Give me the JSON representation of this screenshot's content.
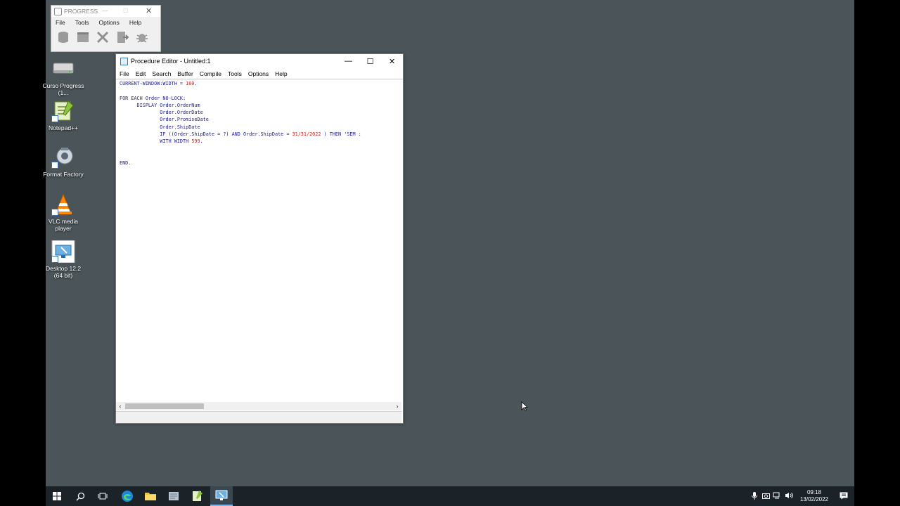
{
  "progress_window": {
    "title": "PROGRESS",
    "menu": [
      "File",
      "Tools",
      "Options",
      "Help"
    ],
    "toolbar_icons": [
      "database-icon",
      "window-icon",
      "cross-tools-icon",
      "document-arrow-icon",
      "bug-icon"
    ]
  },
  "desktop_icons": [
    {
      "label": "Curso Progress (1...",
      "icon": "drive-icon"
    },
    {
      "label": "Notepad++",
      "icon": "notepad-icon"
    },
    {
      "label": "Format Factory",
      "icon": "format-factory-icon"
    },
    {
      "label": "VLC media player",
      "icon": "vlc-icon"
    },
    {
      "label": "Desktop 12.2 (64 bit)",
      "icon": "progress-desktop-icon"
    }
  ],
  "editor": {
    "title": "Procedure Editor - Untitled:1",
    "menu": [
      "File",
      "Edit",
      "Search",
      "Buffer",
      "Compile",
      "Tools",
      "Options",
      "Help"
    ],
    "code": {
      "line1_kw": "CURRENT-WINDOW:WIDTH = ",
      "line1_num": "160",
      "line1_end": ".",
      "line3": "FOR EACH Order NO-LOCK:",
      "line4": "      DISPLAY Order.OrderNum",
      "line5": "              Order.OrderDate",
      "line6": "              Order.PromiseDate",
      "line7": "              Order.ShipDate",
      "line8_a": "              IF ((Order.ShipDate = ?) AND Order.ShipDate = ",
      "line8_date": "31/31/2022",
      "line8_b": " ) THEN 'SEM :",
      "line9_a": "              WITH WIDTH ",
      "line9_num": "599",
      "line9_end": ".",
      "line12": "END."
    }
  },
  "taskbar": {
    "apps": [
      "windows-start-icon",
      "search-icon",
      "task-view-icon",
      "edge-icon",
      "file-explorer-icon",
      "progress-app-icon",
      "notepad-taskbar-icon",
      "procedure-editor-taskbar-icon"
    ],
    "clock_time": "09:18",
    "clock_date": "13/02/2022"
  },
  "colors": {
    "desktop": "#4a5459",
    "taskbar": "#1b2228",
    "code_keyword": "#1a1a8c",
    "code_literal": "#d0201a"
  }
}
